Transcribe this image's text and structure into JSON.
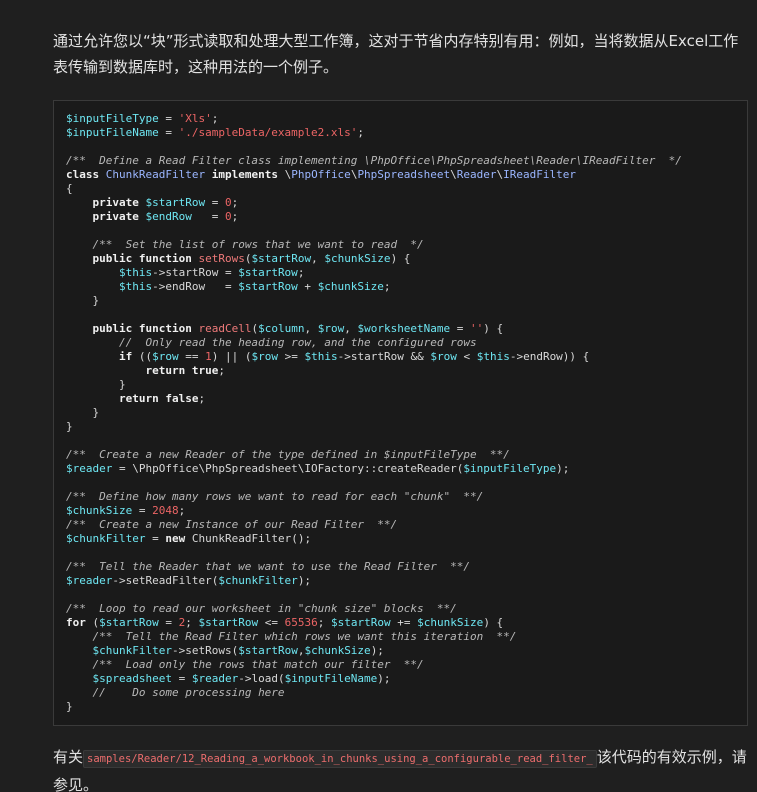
{
  "intro_text": "通过允许您以“块”形式读取和处理大型工作簿，这对于节省内存特别有用：例如，当将数据从Excel工作表传输到数据库时，这种用法的一个例子。",
  "outro": {
    "before": "有关",
    "code": "samples/Reader/12_Reading_a_workbook_in_chunks_using_a_configurable_read_filter_",
    "after": "该代码的有效示例，请参见。"
  },
  "code_lines": [
    [
      [
        "var",
        "$inputFileType"
      ],
      [
        "txt",
        " = "
      ],
      [
        "str",
        "'Xls'"
      ],
      [
        "txt",
        ";"
      ]
    ],
    [
      [
        "var",
        "$inputFileName"
      ],
      [
        "txt",
        " = "
      ],
      [
        "str",
        "'./sampleData/example2.xls'"
      ],
      [
        "txt",
        ";"
      ]
    ],
    [],
    [
      [
        "cmt",
        "/**  Define a Read Filter class implementing \\PhpOffice\\PhpSpreadsheet\\Reader\\IReadFilter  */"
      ]
    ],
    [
      [
        "kw",
        "class"
      ],
      [
        "txt",
        " "
      ],
      [
        "cls",
        "ChunkReadFilter"
      ],
      [
        "txt",
        " "
      ],
      [
        "kw",
        "implements"
      ],
      [
        "txt",
        " \\"
      ],
      [
        "cls",
        "PhpOffice"
      ],
      [
        "txt",
        "\\"
      ],
      [
        "cls",
        "PhpSpreadsheet"
      ],
      [
        "txt",
        "\\"
      ],
      [
        "cls",
        "Reader"
      ],
      [
        "txt",
        "\\"
      ],
      [
        "cls",
        "IReadFilter"
      ]
    ],
    [
      [
        "txt",
        "{"
      ]
    ],
    [
      [
        "txt",
        "    "
      ],
      [
        "kw",
        "private"
      ],
      [
        "txt",
        " "
      ],
      [
        "var",
        "$startRow"
      ],
      [
        "txt",
        " = "
      ],
      [
        "num",
        "0"
      ],
      [
        "txt",
        ";"
      ]
    ],
    [
      [
        "txt",
        "    "
      ],
      [
        "kw",
        "private"
      ],
      [
        "txt",
        " "
      ],
      [
        "var",
        "$endRow"
      ],
      [
        "txt",
        "   = "
      ],
      [
        "num",
        "0"
      ],
      [
        "txt",
        ";"
      ]
    ],
    [],
    [
      [
        "txt",
        "    "
      ],
      [
        "cmt",
        "/**  Set the list of rows that we want to read  */"
      ]
    ],
    [
      [
        "txt",
        "    "
      ],
      [
        "kw",
        "public"
      ],
      [
        "txt",
        " "
      ],
      [
        "kw",
        "function"
      ],
      [
        "txt",
        " "
      ],
      [
        "fn",
        "setRows"
      ],
      [
        "txt",
        "("
      ],
      [
        "var",
        "$startRow"
      ],
      [
        "txt",
        ", "
      ],
      [
        "var",
        "$chunkSize"
      ],
      [
        "txt",
        ") {"
      ]
    ],
    [
      [
        "txt",
        "        "
      ],
      [
        "var",
        "$this"
      ],
      [
        "txt",
        "->startRow = "
      ],
      [
        "var",
        "$startRow"
      ],
      [
        "txt",
        ";"
      ]
    ],
    [
      [
        "txt",
        "        "
      ],
      [
        "var",
        "$this"
      ],
      [
        "txt",
        "->endRow   = "
      ],
      [
        "var",
        "$startRow"
      ],
      [
        "txt",
        " + "
      ],
      [
        "var",
        "$chunkSize"
      ],
      [
        "txt",
        ";"
      ]
    ],
    [
      [
        "txt",
        "    }"
      ]
    ],
    [],
    [
      [
        "txt",
        "    "
      ],
      [
        "kw",
        "public"
      ],
      [
        "txt",
        " "
      ],
      [
        "kw",
        "function"
      ],
      [
        "txt",
        " "
      ],
      [
        "fn",
        "readCell"
      ],
      [
        "txt",
        "("
      ],
      [
        "var",
        "$column"
      ],
      [
        "txt",
        ", "
      ],
      [
        "var",
        "$row"
      ],
      [
        "txt",
        ", "
      ],
      [
        "var",
        "$worksheetName"
      ],
      [
        "txt",
        " = "
      ],
      [
        "str",
        "''"
      ],
      [
        "txt",
        ") {"
      ]
    ],
    [
      [
        "txt",
        "        "
      ],
      [
        "cmt",
        "//  Only read the heading row, and the configured rows"
      ]
    ],
    [
      [
        "txt",
        "        "
      ],
      [
        "kw",
        "if"
      ],
      [
        "txt",
        " (("
      ],
      [
        "var",
        "$row"
      ],
      [
        "txt",
        " == "
      ],
      [
        "num",
        "1"
      ],
      [
        "txt",
        ") || ("
      ],
      [
        "var",
        "$row"
      ],
      [
        "txt",
        " >= "
      ],
      [
        "var",
        "$this"
      ],
      [
        "txt",
        "->startRow && "
      ],
      [
        "var",
        "$row"
      ],
      [
        "txt",
        " < "
      ],
      [
        "var",
        "$this"
      ],
      [
        "txt",
        "->endRow)) {"
      ]
    ],
    [
      [
        "txt",
        "            "
      ],
      [
        "kw",
        "return"
      ],
      [
        "txt",
        " "
      ],
      [
        "kw",
        "true"
      ],
      [
        "txt",
        ";"
      ]
    ],
    [
      [
        "txt",
        "        }"
      ]
    ],
    [
      [
        "txt",
        "        "
      ],
      [
        "kw",
        "return"
      ],
      [
        "txt",
        " "
      ],
      [
        "kw",
        "false"
      ],
      [
        "txt",
        ";"
      ]
    ],
    [
      [
        "txt",
        "    }"
      ]
    ],
    [
      [
        "txt",
        "}"
      ]
    ],
    [],
    [
      [
        "cmt",
        "/**  Create a new Reader of the type defined in $inputFileType  **/"
      ]
    ],
    [
      [
        "var",
        "$reader"
      ],
      [
        "txt",
        " = \\PhpOffice\\PhpSpreadsheet\\IOFactory::createReader("
      ],
      [
        "var",
        "$inputFileType"
      ],
      [
        "txt",
        ");"
      ]
    ],
    [],
    [
      [
        "cmt",
        "/**  Define how many rows we want to read for each \"chunk\"  **/"
      ]
    ],
    [
      [
        "var",
        "$chunkSize"
      ],
      [
        "txt",
        " = "
      ],
      [
        "num",
        "2048"
      ],
      [
        "txt",
        ";"
      ]
    ],
    [
      [
        "cmt",
        "/**  Create a new Instance of our Read Filter  **/"
      ]
    ],
    [
      [
        "var",
        "$chunkFilter"
      ],
      [
        "txt",
        " = "
      ],
      [
        "kw",
        "new"
      ],
      [
        "txt",
        " ChunkReadFilter();"
      ]
    ],
    [],
    [
      [
        "cmt",
        "/**  Tell the Reader that we want to use the Read Filter  **/"
      ]
    ],
    [
      [
        "var",
        "$reader"
      ],
      [
        "txt",
        "->setReadFilter("
      ],
      [
        "var",
        "$chunkFilter"
      ],
      [
        "txt",
        ");"
      ]
    ],
    [],
    [
      [
        "cmt",
        "/**  Loop to read our worksheet in \"chunk size\" blocks  **/"
      ]
    ],
    [
      [
        "kw",
        "for"
      ],
      [
        "txt",
        " ("
      ],
      [
        "var",
        "$startRow"
      ],
      [
        "txt",
        " = "
      ],
      [
        "num",
        "2"
      ],
      [
        "txt",
        "; "
      ],
      [
        "var",
        "$startRow"
      ],
      [
        "txt",
        " <= "
      ],
      [
        "num",
        "65536"
      ],
      [
        "txt",
        "; "
      ],
      [
        "var",
        "$startRow"
      ],
      [
        "txt",
        " += "
      ],
      [
        "var",
        "$chunkSize"
      ],
      [
        "txt",
        ") {"
      ]
    ],
    [
      [
        "txt",
        "    "
      ],
      [
        "cmt",
        "/**  Tell the Read Filter which rows we want this iteration  **/"
      ]
    ],
    [
      [
        "txt",
        "    "
      ],
      [
        "var",
        "$chunkFilter"
      ],
      [
        "txt",
        "->setRows("
      ],
      [
        "var",
        "$startRow"
      ],
      [
        "txt",
        ","
      ],
      [
        "var",
        "$chunkSize"
      ],
      [
        "txt",
        ");"
      ]
    ],
    [
      [
        "txt",
        "    "
      ],
      [
        "cmt",
        "/**  Load only the rows that match our filter  **/"
      ]
    ],
    [
      [
        "txt",
        "    "
      ],
      [
        "var",
        "$spreadsheet"
      ],
      [
        "txt",
        " = "
      ],
      [
        "var",
        "$reader"
      ],
      [
        "txt",
        "->load("
      ],
      [
        "var",
        "$inputFileName"
      ],
      [
        "txt",
        ");"
      ]
    ],
    [
      [
        "txt",
        "    "
      ],
      [
        "cmt",
        "//    Do some processing here"
      ]
    ],
    [
      [
        "txt",
        "}"
      ]
    ]
  ]
}
